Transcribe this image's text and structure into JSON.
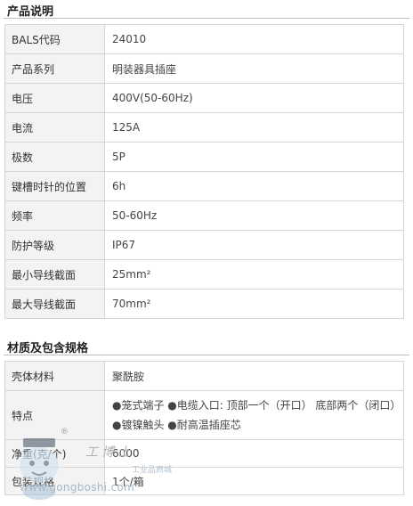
{
  "sections": [
    {
      "title": "产品说明",
      "rows": [
        {
          "label": "BALS代码",
          "value": "24010"
        },
        {
          "label": "产品系列",
          "value": "明装器具插座"
        },
        {
          "label": "电压",
          "value": "400V(50-60Hz)"
        },
        {
          "label": "电流",
          "value": "125A"
        },
        {
          "label": "极数",
          "value": "5P"
        },
        {
          "label": "键槽时针的位置",
          "value": "6h"
        },
        {
          "label": "频率",
          "value": "50-60Hz"
        },
        {
          "label": "防护等级",
          "value": "IP67"
        },
        {
          "label": "最小导线截面",
          "value": "25mm²"
        },
        {
          "label": "最大导线截面",
          "value": "70mm²"
        }
      ]
    },
    {
      "title": "材质及包含规格",
      "rows": [
        {
          "label": "壳体材料",
          "value": "聚酰胺"
        },
        {
          "label": "特点",
          "lines": [
            "●笼式端子 ●电缆入口: 顶部一个（开口） 底部两个（闭口）",
            "●镀镍触头 ●耐高温插座芯"
          ]
        },
        {
          "label": "净重(克/个)",
          "value": "6000"
        },
        {
          "label": "包装规格",
          "value": "1个/箱"
        }
      ]
    }
  ],
  "watermark": {
    "brand": "工博士",
    "site_cn": "工业品商城",
    "url": "www.gongboshi.com",
    "reg": "®"
  }
}
